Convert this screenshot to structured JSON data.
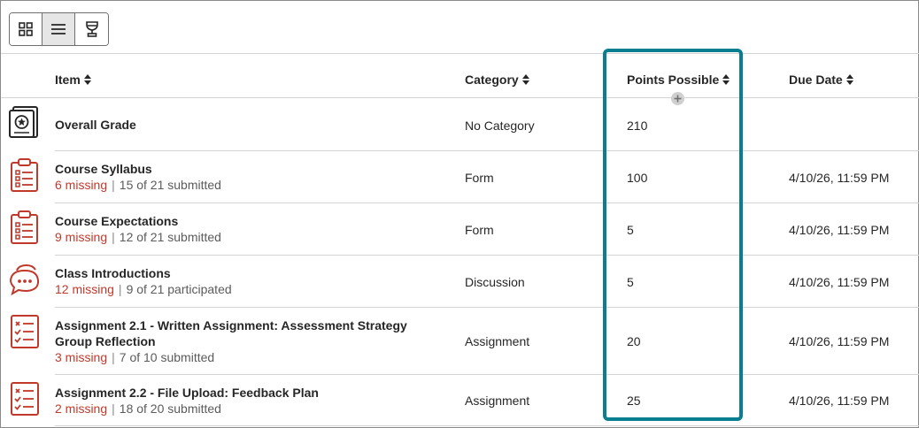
{
  "columns": {
    "item": "Item",
    "category": "Category",
    "points": "Points Possible",
    "due": "Due Date"
  },
  "view_toggle": {
    "options": [
      "grid-view",
      "list-view",
      "trophy-view"
    ],
    "selected": "list-view"
  },
  "rows": [
    {
      "icon": "overall-grade-icon",
      "title": "Overall Grade",
      "category": "No Category",
      "points": "210",
      "due": ""
    },
    {
      "icon": "clipboard-form-icon",
      "title": "Course Syllabus",
      "missing": "6 missing",
      "submitted": "15 of 21 submitted",
      "category": "Form",
      "points": "100",
      "due": "4/10/26, 11:59 PM"
    },
    {
      "icon": "clipboard-form-icon",
      "title": "Course Expectations",
      "missing": "9 missing",
      "submitted": "12 of 21 submitted",
      "category": "Form",
      "points": "5",
      "due": "4/10/26, 11:59 PM"
    },
    {
      "icon": "discussion-icon",
      "title": "Class Introductions",
      "missing": "12 missing",
      "submitted": "9 of 21 participated",
      "category": "Discussion",
      "points": "5",
      "due": "4/10/26, 11:59 PM"
    },
    {
      "icon": "assignment-checklist-icon",
      "title_line1": "Assignment 2.1 - Written Assignment: Assessment Strategy",
      "title_line2": "Group Reflection",
      "missing": "3 missing",
      "submitted": "7 of 10 submitted",
      "category": "Assignment",
      "points": "20",
      "due": "4/10/26, 11:59 PM"
    },
    {
      "icon": "assignment-checklist-icon",
      "title": "Assignment 2.2 - File Upload: Feedback Plan",
      "missing": "2 missing",
      "submitted": "18 of 20 submitted",
      "category": "Assignment",
      "points": "25",
      "due": "4/10/26, 11:59 PM"
    }
  ],
  "separator": "|",
  "colors": {
    "missing": "#c0392b",
    "icon_red": "#c0392b",
    "highlight": "#0a7e91"
  }
}
